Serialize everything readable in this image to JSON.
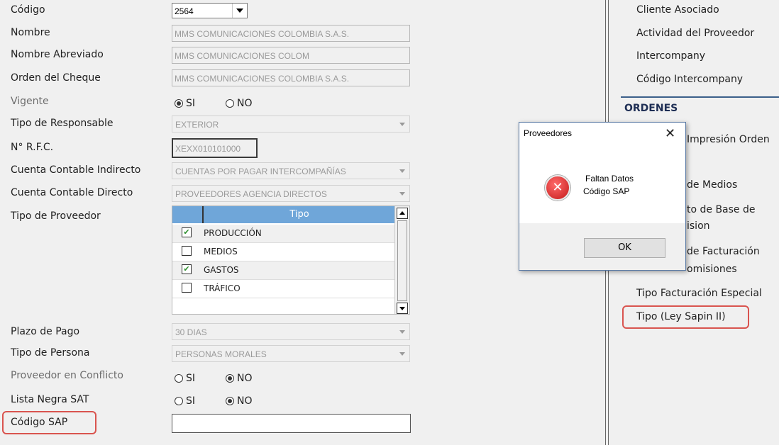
{
  "form": {
    "codigo_label": "Código",
    "codigo_value": "2564",
    "nombre_label": "Nombre",
    "nombre_value": "MMS COMUNICACIONES COLOMBIA S.A.S.",
    "nombre_abrev_label": "Nombre Abreviado",
    "nombre_abrev_value": "MMS COMUNICACIONES COLOM",
    "orden_cheque_label": "Orden del Cheque",
    "orden_cheque_value": "MMS COMUNICACIONES COLOMBIA S.A.S.",
    "vigente_label": "Vigente",
    "tipo_responsable_label": "Tipo de Responsable",
    "tipo_responsable_value": "EXTERIOR",
    "rfc_label": "N° R.F.C.",
    "rfc_value": "XEXX010101000",
    "cuenta_indirecto_label": "Cuenta Contable Indirecto",
    "cuenta_indirecto_value": "CUENTAS POR PAGAR INTERCOMPAÑÍAS",
    "cuenta_directo_label": "Cuenta Contable Directo",
    "cuenta_directo_value": "PROVEEDORES AGENCIA DIRECTOS",
    "tipo_proveedor_label": "Tipo de Proveedor",
    "tipo_header": "Tipo",
    "tipo_items": [
      {
        "label": "PRODUCCIÓN",
        "checked": true
      },
      {
        "label": "MEDIOS",
        "checked": false
      },
      {
        "label": "GASTOS",
        "checked": true
      },
      {
        "label": "TRÁFICO",
        "checked": false
      }
    ],
    "plazo_label": "Plazo de Pago",
    "plazo_value": "30 DIAS",
    "tipo_persona_label": "Tipo de Persona",
    "tipo_persona_value": "PERSONAS MORALES",
    "conflicto_label": "Proveedor en Conflicto",
    "lista_negra_label": "Lista Negra SAT",
    "codigo_sap_label": "Código SAP",
    "codigo_sap_value": "",
    "si": "SI",
    "no": "NO"
  },
  "right_panel": {
    "items_top": [
      "Cliente Asociado",
      "Actividad del Proveedor",
      "Intercompany",
      "Código Intercompany"
    ],
    "section": "ORDENES",
    "impresion": "Impresión Orden",
    "medios": "de Medios",
    "base_line1": "to de Base de",
    "base_line2": "ision",
    "facturacion_line1": "de Facturación",
    "facturacion_line2": "omisiones",
    "tipo_facturacion": "Tipo Facturación Especial",
    "tipo_ley": "Tipo (Ley Sapin II)"
  },
  "dialog": {
    "title": "Proveedores",
    "message_line1": "Faltan Datos",
    "message_line2": "Código SAP",
    "ok": "OK"
  }
}
